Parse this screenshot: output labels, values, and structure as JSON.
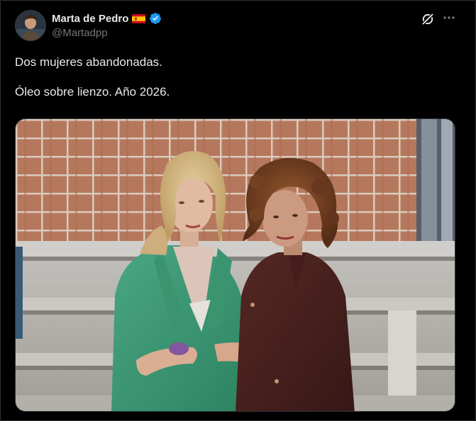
{
  "tweet": {
    "author": {
      "display_name": "Marta de Pedro",
      "handle": "@Martadpp",
      "verified": true,
      "flag": "spain-flag"
    },
    "text_lines": [
      "Dos mujeres abandonadas.",
      "Óleo sobre lienzo. Año 2026."
    ],
    "actions": {
      "grok_icon": "grok-icon",
      "more_icon": "more-options-icon"
    },
    "media": {
      "type": "photo",
      "description_icon": "photo"
    }
  },
  "colors": {
    "background": "#000000",
    "text_primary": "#e7e9ea",
    "text_secondary": "#71767b",
    "verified_blue": "#1d9bf0",
    "border": "#2f3336"
  }
}
